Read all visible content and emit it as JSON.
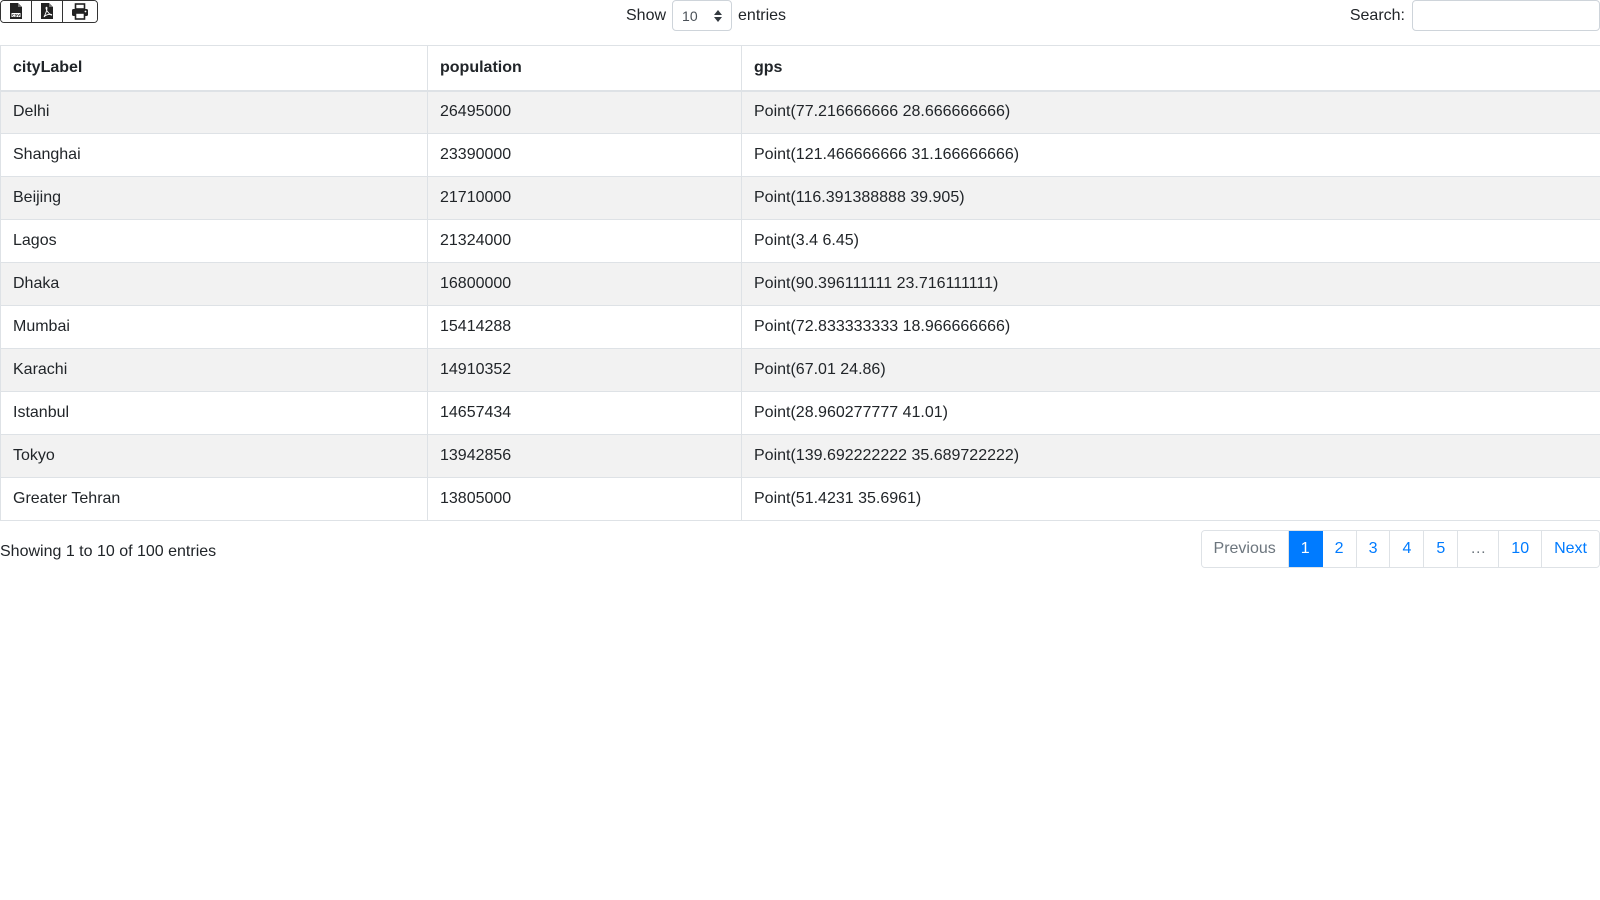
{
  "toolbar": {
    "export_buttons": [
      {
        "icon": "csv-file-icon"
      },
      {
        "icon": "pdf-file-icon"
      },
      {
        "icon": "printer-icon"
      }
    ]
  },
  "length": {
    "show_label": "Show",
    "selected": "10",
    "entries_label": "entries"
  },
  "search": {
    "label": "Search:",
    "value": "",
    "placeholder": ""
  },
  "table": {
    "columns": [
      "cityLabel",
      "population",
      "gps"
    ],
    "rows": [
      [
        "Delhi",
        "26495000",
        "Point(77.216666666 28.666666666)"
      ],
      [
        "Shanghai",
        "23390000",
        "Point(121.466666666 31.166666666)"
      ],
      [
        "Beijing",
        "21710000",
        "Point(116.391388888 39.905)"
      ],
      [
        "Lagos",
        "21324000",
        "Point(3.4 6.45)"
      ],
      [
        "Dhaka",
        "16800000",
        "Point(90.396111111 23.716111111)"
      ],
      [
        "Mumbai",
        "15414288",
        "Point(72.833333333 18.966666666)"
      ],
      [
        "Karachi",
        "14910352",
        "Point(67.01 24.86)"
      ],
      [
        "Istanbul",
        "14657434",
        "Point(28.960277777 41.01)"
      ],
      [
        "Tokyo",
        "13942856",
        "Point(139.692222222 35.689722222)"
      ],
      [
        "Greater Tehran",
        "13805000",
        "Point(51.4231 35.6961)"
      ]
    ]
  },
  "info": "Showing 1 to 10 of 100 entries",
  "pagination": {
    "previous": "Previous",
    "pages": [
      "1",
      "2",
      "3",
      "4",
      "5",
      "…",
      "10"
    ],
    "active_page": "1",
    "next": "Next"
  },
  "colors": {
    "accent": "#007bff",
    "stripe": "#f2f2f2",
    "border": "#dee2e6"
  }
}
